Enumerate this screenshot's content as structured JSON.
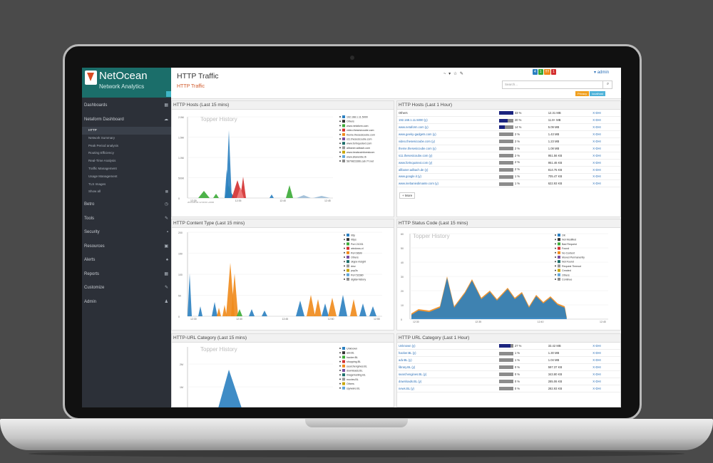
{
  "app": {
    "name": "NetOcean",
    "subtitle": "Network Analytics"
  },
  "sidebar": {
    "items": [
      {
        "label": "Dashboards",
        "icon": "dashboard-icon"
      },
      {
        "label": "Netaform Dashboard",
        "icon": "cloud-icon"
      }
    ],
    "sub_items": [
      "HTTP",
      "Network Summary",
      "Peak Period analysis",
      "Routing Efficiency",
      "Real-Time Analysis",
      "Traffic Management",
      "Usage Management",
      "TLS Images",
      "Show all"
    ],
    "active_sub": "HTTP",
    "bottom_items": [
      {
        "label": "Betro",
        "icon": "clock-icon"
      },
      {
        "label": "Tools",
        "icon": "wrench-icon"
      },
      {
        "label": "Security",
        "icon": "lock-icon"
      },
      {
        "label": "Resources",
        "icon": "picture-icon"
      },
      {
        "label": "Alerts",
        "icon": "bell-icon"
      },
      {
        "label": "Reports",
        "icon": "calendar-icon"
      },
      {
        "label": "Customize",
        "icon": "wrench-icon"
      },
      {
        "label": "Admin",
        "icon": "user-icon"
      }
    ]
  },
  "header": {
    "title": "HTTP Traffic",
    "breadcrumb": "HTTP Traffic",
    "tools": "~ ▾ ☆ ✎",
    "search_placeholder": "Search...",
    "user": "admin",
    "badges": [
      "4",
      "1",
      "!!!!",
      "1"
    ],
    "tags": [
      "Privacy",
      "localhost"
    ]
  },
  "colors": {
    "accent": "#1b6e6a",
    "orange": "#f0891a",
    "blue": "#2a7fc0",
    "green": "#3aaa35",
    "red": "#d32f2f",
    "navy": "#1a237e"
  },
  "panels": {
    "hosts15": {
      "title": "HTTP Hosts (Last 15 mins)",
      "chart_title": "Topper History",
      "legend": [
        "192.168.1.11.5000",
        "Others",
        "www.netaform.com",
        "video.thesesicoube.com",
        "theme.thesesicoube.com",
        "s11.thesesicoube.com",
        "www.fortnquotext.com",
        "allbaner.adbach.com",
        "www.treatsrainforestcom",
        "www.silanerdie.ib",
        "5879823366.cab.YY.net"
      ],
      "xticks": [
        "12:30",
        "12:35",
        "12:40",
        "12:45"
      ],
      "yticks": [
        "2.0M",
        "1.5M",
        "1.0M",
        "500K",
        "0"
      ],
      "date": "2014-08-06 12:30:00 +0000"
    },
    "hosts1h": {
      "title": "HTTP Hosts (Last 1 Hour)",
      "more": "More",
      "rows": [
        {
          "host": "Others",
          "pct": "33 %",
          "size": "12.31 MB",
          "link": "X-DHI",
          "bar": 0.33
        },
        {
          "host": "192.168.1.11.5000 (y)",
          "pct": "20 %",
          "size": "11.8+ MB",
          "link": "X-DHI",
          "bar": 0.2
        },
        {
          "host": "www.netaform.com (y)",
          "pct": "14 %",
          "size": "5.09 MB",
          "link": "X-DHI",
          "bar": 0.14
        },
        {
          "host": "www.geeky-gadgets.com (y)",
          "pct": "2 %",
          "size": "1.43 MB",
          "link": "X-DHI",
          "bar": 0.0
        },
        {
          "host": "video.thesesicoube.com (y)",
          "pct": "2 %",
          "size": "1.23 MB",
          "link": "X-DHI",
          "bar": 0.0
        },
        {
          "host": "theme.thesesicoube.com (y)",
          "pct": "2 %",
          "size": "1.08 MB",
          "link": "X-DHI",
          "bar": 0.0
        },
        {
          "host": "s11.thesesicoube.com (y)",
          "pct": "2 %",
          "size": "951.56 KB",
          "link": "X-DHI",
          "bar": 0.0
        },
        {
          "host": "www.fortnquotext.com (y)",
          "pct": "2 %",
          "size": "951.46 KB",
          "link": "X-DHI",
          "bar": 0.0
        },
        {
          "host": "allbaner.adbach.de (y)",
          "pct": "2 %",
          "size": "814.75 KB",
          "link": "X-DHI",
          "bar": 0.0
        },
        {
          "host": "www.google.it (y)",
          "pct": "1 %",
          "size": "705.47 KB",
          "link": "X-DHI",
          "bar": 0.0
        },
        {
          "host": "www.inebaniedimante.com (y)",
          "pct": "1 %",
          "size": "622.93 KB",
          "link": "X-DHI",
          "bar": 0.0
        }
      ]
    },
    "content15": {
      "title": "HTTP Content Type (Last 15 mins)",
      "legend": [
        "http",
        "https",
        "Port 21031",
        "windows-xl",
        "Port 6699",
        "Others",
        "skype-insight",
        "dmz",
        "pop3s",
        "Port 52380",
        "digital-history"
      ],
      "yticks": [
        "200",
        "150",
        "100",
        "50",
        "0"
      ],
      "xticks": [
        "12:30",
        "12:40",
        "12:45",
        "12:50",
        "12:55"
      ]
    },
    "status15": {
      "title": "HTTP Status Code (Last 15 mins)",
      "chart_title": "Topper History",
      "legend": [
        "OK",
        "Not Modified",
        "Bad Request",
        "Found",
        "No Content",
        "Moved Permanently",
        "Not Found",
        "Request Timeout",
        "Created",
        "Others",
        "Continue"
      ],
      "yticks": [
        "60",
        "50",
        "40",
        "30",
        "20",
        "10",
        "0"
      ],
      "xticks": [
        "12:30",
        "12:35",
        "12:40",
        "12:45"
      ]
    },
    "url15": {
      "title": "HTTP-URL Category (Last 15 mins)",
      "chart_title": "Topper History",
      "legend": [
        "Unknown",
        "adv.BL",
        "hacker.BL",
        "shopping.BL",
        "searchengines.BL",
        "downloads.BL",
        "imagehosting.BL",
        "movies.BL",
        "Others",
        "spyware.BL"
      ],
      "yticks": [
        "2M",
        "1M"
      ]
    },
    "url1h": {
      "title": "HTTP URL Category (Last 1 Hour)",
      "rows": [
        {
          "cat": "Unknown (y)",
          "pct": "27 %",
          "size": "33.42 MB",
          "link": "X-DHI",
          "bar": 0.27
        },
        {
          "cat": "hacker.BL (y)",
          "pct": "1 %",
          "size": "1.30 MB",
          "link": "X-DHI",
          "bar": 0.0
        },
        {
          "cat": "adv.BL (y)",
          "pct": "1 %",
          "size": "1.04 MB",
          "link": "X-DHI",
          "bar": 0.0
        },
        {
          "cat": "library.BL (y)",
          "pct": "0 %",
          "size": "597.37 KB",
          "link": "X-DHI",
          "bar": 0.0
        },
        {
          "cat": "searchengines.BL (y)",
          "pct": "0 %",
          "size": "343.80 KB",
          "link": "X-DHI",
          "bar": 0.0
        },
        {
          "cat": "downloads.BL (y)",
          "pct": "0 %",
          "size": "285.06 KB",
          "link": "X-DHI",
          "bar": 0.0
        },
        {
          "cat": "news.BL (y)",
          "pct": "0 %",
          "size": "282.93 KB",
          "link": "X-DHI",
          "bar": 0.0
        }
      ]
    }
  }
}
